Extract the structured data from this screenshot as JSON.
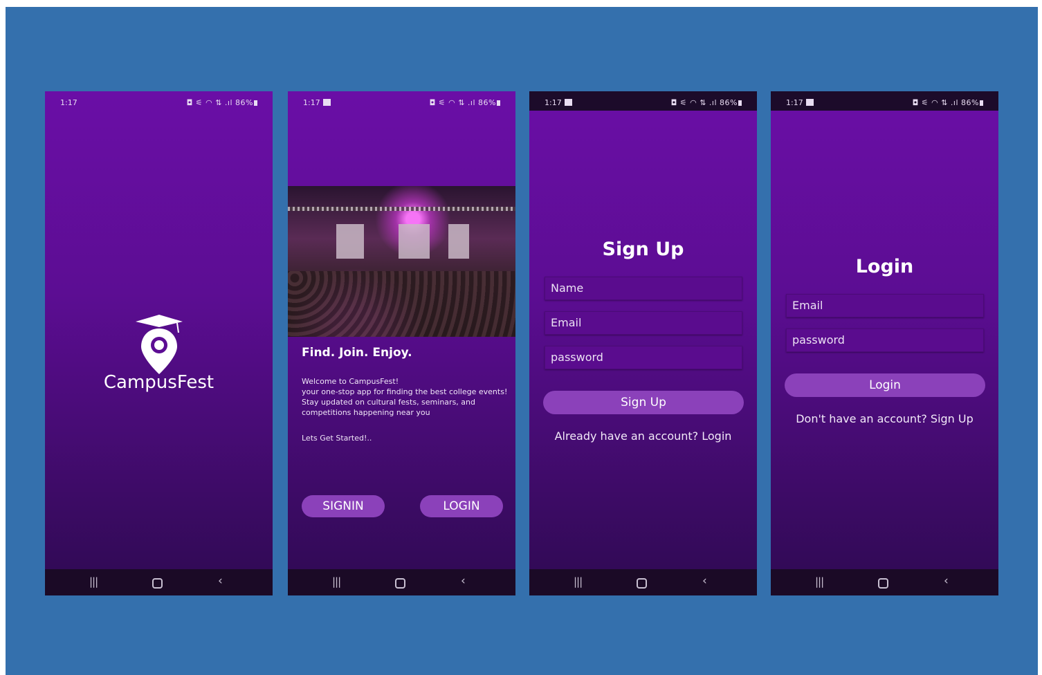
{
  "status_bar": {
    "time": "1:17",
    "indicators": "◘ ⚟ ◠ ⇅ .ıl",
    "battery": "86%"
  },
  "nav_bar": {
    "recent": "|||",
    "back": "‹"
  },
  "splash": {
    "brand": "CampusFest"
  },
  "onboarding": {
    "headline": "Find. Join. Enjoy.",
    "welcome_lines": [
      "Welcome to CampusFest!",
      "your one-stop app for finding the best college events! Stay updated on cultural fests, seminars, and competitions happening near you"
    ],
    "cta_text": "Lets Get Started!..",
    "signin_label": "SIGNIN",
    "login_label": "LOGIN"
  },
  "signup": {
    "title": "Sign Up",
    "name_placeholder": "Name",
    "email_placeholder": "Email",
    "password_placeholder": "password",
    "button_label": "Sign Up",
    "switch_text": "Already have an account? Login"
  },
  "login": {
    "title": "Login",
    "email_placeholder": "Email",
    "password_placeholder": "password",
    "button_label": "Login",
    "switch_text": "Don't have an account? Sign Up"
  },
  "colors": {
    "background": "#3470ad",
    "phone_gradient_top": "#6a0ea6",
    "phone_gradient_bottom": "#2e0a52",
    "button": "#8b41ba",
    "navbar": "#1b0a26"
  }
}
